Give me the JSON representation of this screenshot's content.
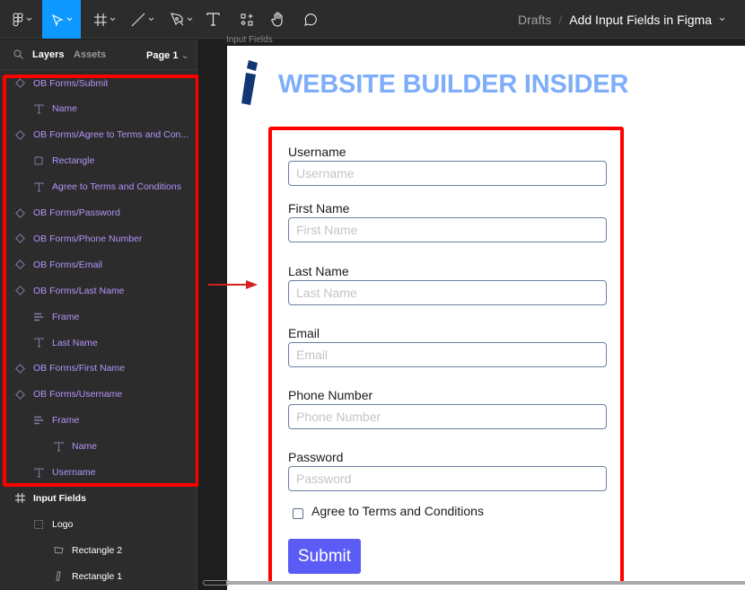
{
  "toolbar": {
    "tools": [
      {
        "name": "main-menu",
        "icon": "figma-logo-icon",
        "has_dropdown": true
      },
      {
        "name": "move-tool",
        "icon": "cursor-arrow-icon",
        "has_dropdown": true,
        "active": true
      },
      {
        "name": "frame-tool",
        "icon": "frame-hash-icon",
        "has_dropdown": true
      },
      {
        "name": "line-tool",
        "icon": "line-icon",
        "has_dropdown": true
      },
      {
        "name": "pen-tool",
        "icon": "pen-icon",
        "has_dropdown": true
      },
      {
        "name": "text-tool",
        "icon": "text-icon",
        "has_dropdown": false
      },
      {
        "name": "resources-tool",
        "icon": "resources-icon",
        "has_dropdown": false
      },
      {
        "name": "hand-tool",
        "icon": "hand-icon",
        "has_dropdown": false
      },
      {
        "name": "comment-tool",
        "icon": "comment-icon",
        "has_dropdown": false
      }
    ],
    "breadcrumb": {
      "parent": "Drafts",
      "separator": "/",
      "file_name": "Add Input Fields in Figma"
    },
    "accent_color": "#0d99ff"
  },
  "left_panel": {
    "tabs": {
      "layers": "Layers",
      "assets": "Assets",
      "page": "Page 1"
    },
    "layers": [
      {
        "label": "OB Forms/Submit",
        "type": "component",
        "icon": "component-diamond-icon",
        "level": 0
      },
      {
        "label": "Name",
        "type": "component",
        "icon": "text-icon",
        "level": 1
      },
      {
        "label": "OB Forms/Agree to Terms and Con...",
        "type": "component",
        "icon": "component-diamond-icon",
        "level": 0
      },
      {
        "label": "Rectangle",
        "type": "component",
        "icon": "rectangle-icon",
        "level": 1
      },
      {
        "label": "Agree to Terms and Conditions",
        "type": "component",
        "icon": "text-icon",
        "level": 1
      },
      {
        "label": "OB Forms/Password",
        "type": "component",
        "icon": "component-diamond-icon",
        "level": 0
      },
      {
        "label": "OB Forms/Phone Number",
        "type": "component",
        "icon": "component-diamond-icon",
        "level": 0
      },
      {
        "label": "OB Forms/Email",
        "type": "component",
        "icon": "component-diamond-icon",
        "level": 0
      },
      {
        "label": "OB Forms/Last Name",
        "type": "component",
        "icon": "component-diamond-icon",
        "level": 0
      },
      {
        "label": "Frame",
        "type": "component",
        "icon": "auto-layout-icon",
        "level": 1
      },
      {
        "label": "Last Name",
        "type": "component",
        "icon": "text-icon",
        "level": 1
      },
      {
        "label": "OB Forms/First Name",
        "type": "component",
        "icon": "component-diamond-icon",
        "level": 0
      },
      {
        "label": "OB Forms/Username",
        "type": "component",
        "icon": "component-diamond-icon",
        "level": 0
      },
      {
        "label": "Frame",
        "type": "component",
        "icon": "auto-layout-icon",
        "level": 1
      },
      {
        "label": "Name",
        "type": "component",
        "icon": "text-icon",
        "level": 2
      },
      {
        "label": "Username",
        "type": "component",
        "icon": "text-icon",
        "level": 1
      },
      {
        "label": "Input Fields",
        "type": "frame",
        "icon": "frame-hash-icon",
        "level": 0,
        "bold": true
      },
      {
        "label": "Logo",
        "type": "group",
        "icon": "group-dashed-icon",
        "level": 1
      },
      {
        "label": "Rectangle 2",
        "type": "shape",
        "icon": "skewed-rectangle-icon",
        "level": 2
      },
      {
        "label": "Rectangle 1",
        "type": "shape",
        "icon": "slanted-bar-icon",
        "level": 2
      }
    ],
    "component_color": "#b394f9"
  },
  "canvas": {
    "frame_label": "Input Fields",
    "logo": {
      "mark": "i",
      "text": "WEBSITE BUILDER INSIDER",
      "mark_color": "#123774",
      "text_color": "#7eadf9"
    },
    "form": {
      "fields": [
        {
          "label": "Username",
          "placeholder": "Username"
        },
        {
          "label": "First Name",
          "placeholder": "First Name"
        },
        {
          "label": "Last Name",
          "placeholder": "Last Name"
        },
        {
          "label": "Email",
          "placeholder": "Email"
        },
        {
          "label": "Phone Number",
          "placeholder": "Phone Number"
        },
        {
          "label": "Password",
          "placeholder": "Password"
        }
      ],
      "checkbox": {
        "label": "Agree to Terms and Conditions",
        "checked": false
      },
      "submit_label": "Submit",
      "submit_color": "#5b5cf6"
    },
    "annotation_color": "#ff0000"
  }
}
